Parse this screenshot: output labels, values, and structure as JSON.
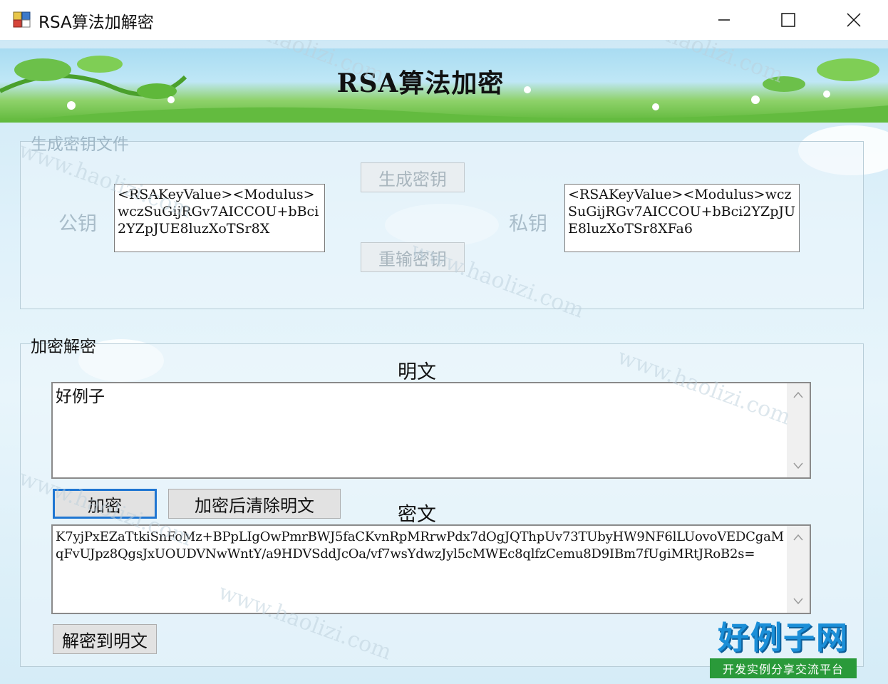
{
  "window": {
    "title": "RSA算法加解密"
  },
  "banner": {
    "title": "RSA算法加密"
  },
  "keys_group": {
    "legend": "生成密钥文件",
    "public_label": "公钥",
    "private_label": "私钥",
    "public_key": "<RSAKeyValue><Modulus>wczSuGijRGv7AICCOU+bBci2YZpJUE8luzXoTSr8X",
    "private_key": "<RSAKeyValue><Modulus>wczSuGijRGv7AICCOU+bBci2YZpJUE8luzXoTSr8XFa6",
    "generate_button": "生成密钥",
    "reinput_button": "重输密钥"
  },
  "crypt_group": {
    "legend": "加密解密",
    "plaintext_label": "明文",
    "plaintext_value": "好例子",
    "encrypt_button": "加密",
    "encrypt_clear_button": "加密后清除明文",
    "ciphertext_label": "密文",
    "ciphertext_value": "K7yjPxEZaTtkiSnFoMz+BPpLIgOwPmrBWJ5faCKvnRpMRrwPdx7dOgJQThpUv73TUbyHW9NF6lLUovoVEDCgaMqFvUJpz8QgsJxUOUDVNwWntY/a9HDVSddJcOa/vf7wsYdwzJyl5cMWEc8qlfzCemu8D9IBm7fUgiMRtJRoB2s=",
    "decrypt_button": "解密到明文"
  },
  "watermark": "www.haolizi.com",
  "logo": {
    "main": "好例子网",
    "sub": "开发实例分享交流平台"
  },
  "colors": {
    "focus_border": "#1f76d2",
    "logo_blue": "#1b8fd8",
    "logo_green": "#2a9a3a"
  }
}
